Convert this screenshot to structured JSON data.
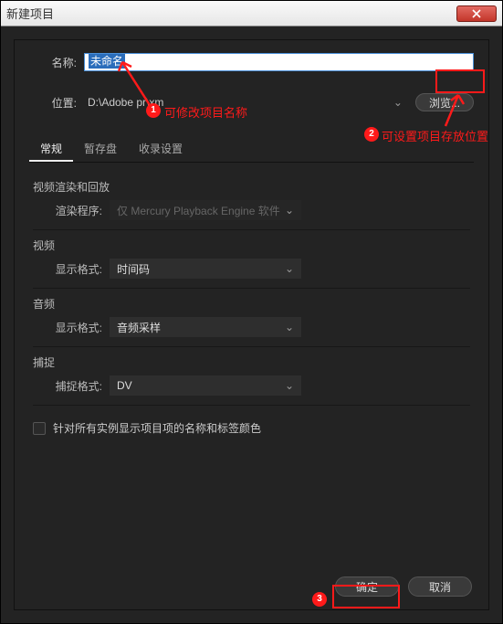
{
  "window": {
    "title": "新建项目"
  },
  "name": {
    "label": "名称:",
    "value": "未命名"
  },
  "location": {
    "label": "位置:",
    "value": "D:\\Adobe pr\\xm",
    "browse_label": "浏览..."
  },
  "tabs": [
    "常规",
    "暂存盘",
    "收录设置"
  ],
  "render": {
    "section_title": "视频渲染和回放",
    "renderer_label": "渲染程序:",
    "renderer_value": "仅 Mercury Playback Engine 软件"
  },
  "video": {
    "section_title": "视频",
    "display_label": "显示格式:",
    "display_value": "时间码"
  },
  "audio": {
    "section_title": "音频",
    "display_label": "显示格式:",
    "display_value": "音频采样"
  },
  "capture": {
    "section_title": "捕捉",
    "format_label": "捕捉格式:",
    "format_value": "DV"
  },
  "checkbox": {
    "label": "针对所有实例显示项目项的名称和标签颜色"
  },
  "footer": {
    "ok_label": "确定",
    "cancel_label": "取消"
  },
  "annotations": {
    "a1_text": "可修改项目名称",
    "a2_text": "可设置项目存放位置",
    "a1_num": "1",
    "a2_num": "2",
    "a3_num": "3"
  }
}
